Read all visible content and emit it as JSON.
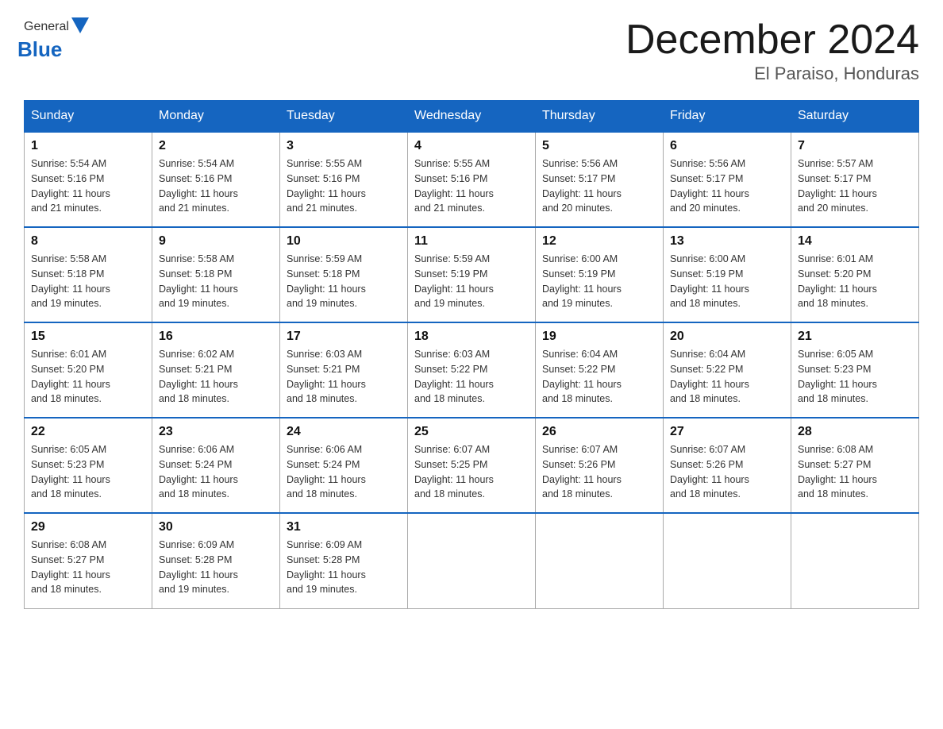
{
  "logo": {
    "general": "General",
    "arrow": "▲",
    "blue": "Blue"
  },
  "title": "December 2024",
  "subtitle": "El Paraiso, Honduras",
  "days_header": [
    "Sunday",
    "Monday",
    "Tuesday",
    "Wednesday",
    "Thursday",
    "Friday",
    "Saturday"
  ],
  "weeks": [
    [
      {
        "day": "1",
        "sunrise": "5:54 AM",
        "sunset": "5:16 PM",
        "daylight": "11 hours and 21 minutes."
      },
      {
        "day": "2",
        "sunrise": "5:54 AM",
        "sunset": "5:16 PM",
        "daylight": "11 hours and 21 minutes."
      },
      {
        "day": "3",
        "sunrise": "5:55 AM",
        "sunset": "5:16 PM",
        "daylight": "11 hours and 21 minutes."
      },
      {
        "day": "4",
        "sunrise": "5:55 AM",
        "sunset": "5:16 PM",
        "daylight": "11 hours and 21 minutes."
      },
      {
        "day": "5",
        "sunrise": "5:56 AM",
        "sunset": "5:17 PM",
        "daylight": "11 hours and 20 minutes."
      },
      {
        "day": "6",
        "sunrise": "5:56 AM",
        "sunset": "5:17 PM",
        "daylight": "11 hours and 20 minutes."
      },
      {
        "day": "7",
        "sunrise": "5:57 AM",
        "sunset": "5:17 PM",
        "daylight": "11 hours and 20 minutes."
      }
    ],
    [
      {
        "day": "8",
        "sunrise": "5:58 AM",
        "sunset": "5:18 PM",
        "daylight": "11 hours and 19 minutes."
      },
      {
        "day": "9",
        "sunrise": "5:58 AM",
        "sunset": "5:18 PM",
        "daylight": "11 hours and 19 minutes."
      },
      {
        "day": "10",
        "sunrise": "5:59 AM",
        "sunset": "5:18 PM",
        "daylight": "11 hours and 19 minutes."
      },
      {
        "day": "11",
        "sunrise": "5:59 AM",
        "sunset": "5:19 PM",
        "daylight": "11 hours and 19 minutes."
      },
      {
        "day": "12",
        "sunrise": "6:00 AM",
        "sunset": "5:19 PM",
        "daylight": "11 hours and 19 minutes."
      },
      {
        "day": "13",
        "sunrise": "6:00 AM",
        "sunset": "5:19 PM",
        "daylight": "11 hours and 18 minutes."
      },
      {
        "day": "14",
        "sunrise": "6:01 AM",
        "sunset": "5:20 PM",
        "daylight": "11 hours and 18 minutes."
      }
    ],
    [
      {
        "day": "15",
        "sunrise": "6:01 AM",
        "sunset": "5:20 PM",
        "daylight": "11 hours and 18 minutes."
      },
      {
        "day": "16",
        "sunrise": "6:02 AM",
        "sunset": "5:21 PM",
        "daylight": "11 hours and 18 minutes."
      },
      {
        "day": "17",
        "sunrise": "6:03 AM",
        "sunset": "5:21 PM",
        "daylight": "11 hours and 18 minutes."
      },
      {
        "day": "18",
        "sunrise": "6:03 AM",
        "sunset": "5:22 PM",
        "daylight": "11 hours and 18 minutes."
      },
      {
        "day": "19",
        "sunrise": "6:04 AM",
        "sunset": "5:22 PM",
        "daylight": "11 hours and 18 minutes."
      },
      {
        "day": "20",
        "sunrise": "6:04 AM",
        "sunset": "5:22 PM",
        "daylight": "11 hours and 18 minutes."
      },
      {
        "day": "21",
        "sunrise": "6:05 AM",
        "sunset": "5:23 PM",
        "daylight": "11 hours and 18 minutes."
      }
    ],
    [
      {
        "day": "22",
        "sunrise": "6:05 AM",
        "sunset": "5:23 PM",
        "daylight": "11 hours and 18 minutes."
      },
      {
        "day": "23",
        "sunrise": "6:06 AM",
        "sunset": "5:24 PM",
        "daylight": "11 hours and 18 minutes."
      },
      {
        "day": "24",
        "sunrise": "6:06 AM",
        "sunset": "5:24 PM",
        "daylight": "11 hours and 18 minutes."
      },
      {
        "day": "25",
        "sunrise": "6:07 AM",
        "sunset": "5:25 PM",
        "daylight": "11 hours and 18 minutes."
      },
      {
        "day": "26",
        "sunrise": "6:07 AM",
        "sunset": "5:26 PM",
        "daylight": "11 hours and 18 minutes."
      },
      {
        "day": "27",
        "sunrise": "6:07 AM",
        "sunset": "5:26 PM",
        "daylight": "11 hours and 18 minutes."
      },
      {
        "day": "28",
        "sunrise": "6:08 AM",
        "sunset": "5:27 PM",
        "daylight": "11 hours and 18 minutes."
      }
    ],
    [
      {
        "day": "29",
        "sunrise": "6:08 AM",
        "sunset": "5:27 PM",
        "daylight": "11 hours and 18 minutes."
      },
      {
        "day": "30",
        "sunrise": "6:09 AM",
        "sunset": "5:28 PM",
        "daylight": "11 hours and 19 minutes."
      },
      {
        "day": "31",
        "sunrise": "6:09 AM",
        "sunset": "5:28 PM",
        "daylight": "11 hours and 19 minutes."
      },
      null,
      null,
      null,
      null
    ]
  ],
  "labels": {
    "sunrise": "Sunrise:",
    "sunset": "Sunset:",
    "daylight": "Daylight:"
  }
}
